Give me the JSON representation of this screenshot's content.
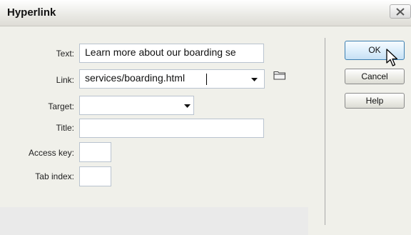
{
  "window": {
    "title": "Hyperlink"
  },
  "form": {
    "text_label": "Text:",
    "text_value": "Learn more about our boarding se",
    "link_label": "Link:",
    "link_value": "services/boarding.html",
    "target_label": "Target:",
    "target_value": "",
    "title_label": "Title:",
    "title_value": "",
    "access_key_label": "Access key:",
    "access_key_value": "",
    "tab_index_label": "Tab index:",
    "tab_index_value": ""
  },
  "buttons": {
    "ok": "OK",
    "cancel": "Cancel",
    "help": "Help"
  },
  "icons": {
    "close": "close-icon",
    "link_dropdown": "chevron-down-icon",
    "target_dropdown": "chevron-down-icon",
    "browse": "folder-icon",
    "pointer": "mouse-pointer-icon"
  }
}
